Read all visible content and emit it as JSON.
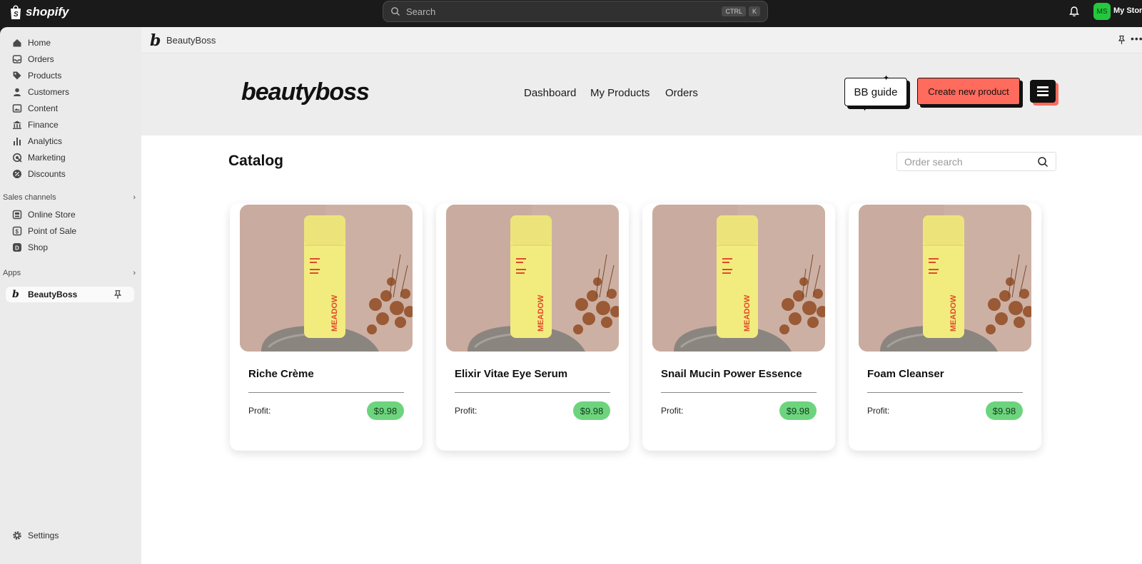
{
  "topbar": {
    "logo_text": "shopify",
    "search_placeholder": "Search",
    "shortcut_keys": [
      "CTRL",
      "K"
    ],
    "avatar_initials": "MS",
    "store_name": "My Store"
  },
  "sidebar": {
    "items": [
      {
        "label": "Home",
        "icon": "home-icon"
      },
      {
        "label": "Orders",
        "icon": "inbox-icon"
      },
      {
        "label": "Products",
        "icon": "tag-icon"
      },
      {
        "label": "Customers",
        "icon": "person-icon"
      },
      {
        "label": "Content",
        "icon": "image-icon"
      },
      {
        "label": "Finance",
        "icon": "bank-icon"
      },
      {
        "label": "Analytics",
        "icon": "bar-chart-icon"
      },
      {
        "label": "Marketing",
        "icon": "target-icon"
      },
      {
        "label": "Discounts",
        "icon": "discount-icon"
      }
    ],
    "sales_channels_label": "Sales channels",
    "sales_channels": [
      {
        "label": "Online Store",
        "icon": "store-icon"
      },
      {
        "label": "Point of Sale",
        "icon": "pos-icon"
      },
      {
        "label": "Shop",
        "icon": "shop-icon"
      }
    ],
    "apps_label": "Apps",
    "active_app": "BeautyBoss",
    "settings_label": "Settings"
  },
  "app_header": {
    "app_letter": "b",
    "app_name": "BeautyBoss"
  },
  "hero": {
    "brand": "beautyboss",
    "nav": [
      "Dashboard",
      "My Products",
      "Orders"
    ],
    "guide_button": "BB guide",
    "create_button": "Create new product"
  },
  "catalog": {
    "title": "Catalog",
    "search_placeholder": "Order search",
    "bottle_text": "MEADOW",
    "profit_label": "Profit:",
    "products": [
      {
        "name": "Riche Crème",
        "profit": "$9.98"
      },
      {
        "name": "Elixir Vitae Eye Serum",
        "profit": "$9.98"
      },
      {
        "name": "Snail Mucin Power Essence",
        "profit": "$9.98"
      },
      {
        "name": "Foam Cleanser",
        "profit": "$9.98"
      }
    ]
  },
  "colors": {
    "accent_coral": "#ff6b5c",
    "profit_green": "#6dd47e",
    "bottle_yellow": "#f2ec7e",
    "topbar": "#1a1a1a"
  }
}
